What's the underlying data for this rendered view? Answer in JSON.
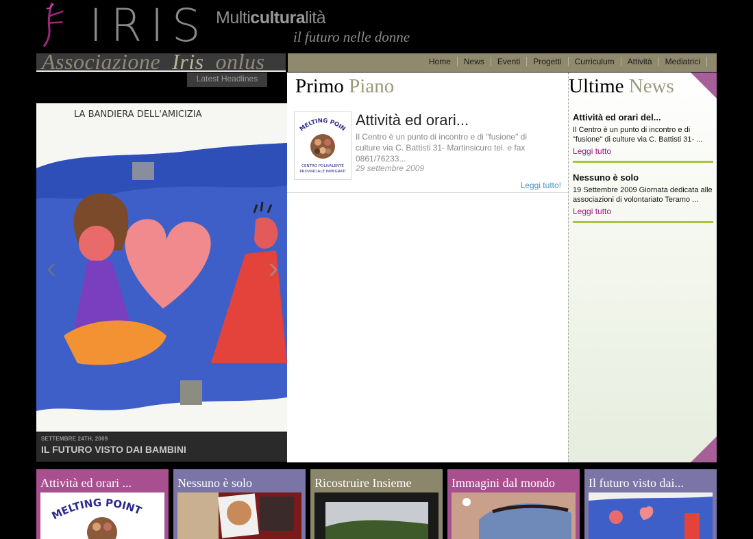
{
  "header": {
    "logo_text": "IRIS",
    "tagline_pre": "Multi",
    "tagline_bold": "cultura",
    "tagline_post": "lità",
    "tagline_sub": "il futuro nelle donne"
  },
  "assoc": {
    "word1": "Associazione",
    "word2": "Iris",
    "word3": "onlus"
  },
  "nav": {
    "items": [
      "Home",
      "News",
      "Eventi",
      "Progetti",
      "Curriculum",
      "Attività",
      "Mediatrici"
    ]
  },
  "slideshow": {
    "tab_label": "Latest Headlines",
    "drawing_text": "LA BANDIERA DELL'AMICIZIA",
    "date": "SETTEMBRE 24TH, 2009",
    "title": "IL FUTURO VISTO DAI BAMBINI",
    "prev_icon": "‹",
    "next_icon": "›"
  },
  "primo": {
    "title_a": "Primo",
    "title_b": "Piano",
    "article": {
      "thumb_top": "MELTING POINT",
      "thumb_bottom_1": "CENTRO POLIVALENTE",
      "thumb_bottom_2": "PROVINCIALE IMMIGRATI",
      "title": "Attività ed orari...",
      "excerpt": "Il Centro è un punto di incontro e di \"fusione\" di culture via C. Battisti 31- Martinsicuro tel. e fax 0861/76233...",
      "date": "29 settembre 2009",
      "more": "Leggi tutto!"
    }
  },
  "ultime": {
    "title_a": "Ultime",
    "title_b": "News",
    "items": [
      {
        "title": "Attività ed orari del...",
        "excerpt": "Il Centro è un punto di incontro e di \"fusione\" di culture via C. Battisti 31- ...",
        "more": "Leggi tutto"
      },
      {
        "title": "Nessuno è solo",
        "excerpt": "19 Settembre 2009 Giornata dedicata alle associazioni di volontariato Teramo ...",
        "more": "Leggi tutto"
      }
    ]
  },
  "cards": [
    {
      "title": "Attività ed orari ...",
      "img_text": "MELTING POINT"
    },
    {
      "title": "Nessuno è solo"
    },
    {
      "title": "Ricostruire Insieme"
    },
    {
      "title": "Immagini dal mondo"
    },
    {
      "title": "Il futuro visto dai..."
    }
  ],
  "colors": {
    "nav_bg": "#8f8a6d",
    "accent_magenta": "#a75f9a",
    "accent_green": "#a8c43c",
    "link_blue": "#4a94c4",
    "link_magenta": "#a0177f"
  }
}
